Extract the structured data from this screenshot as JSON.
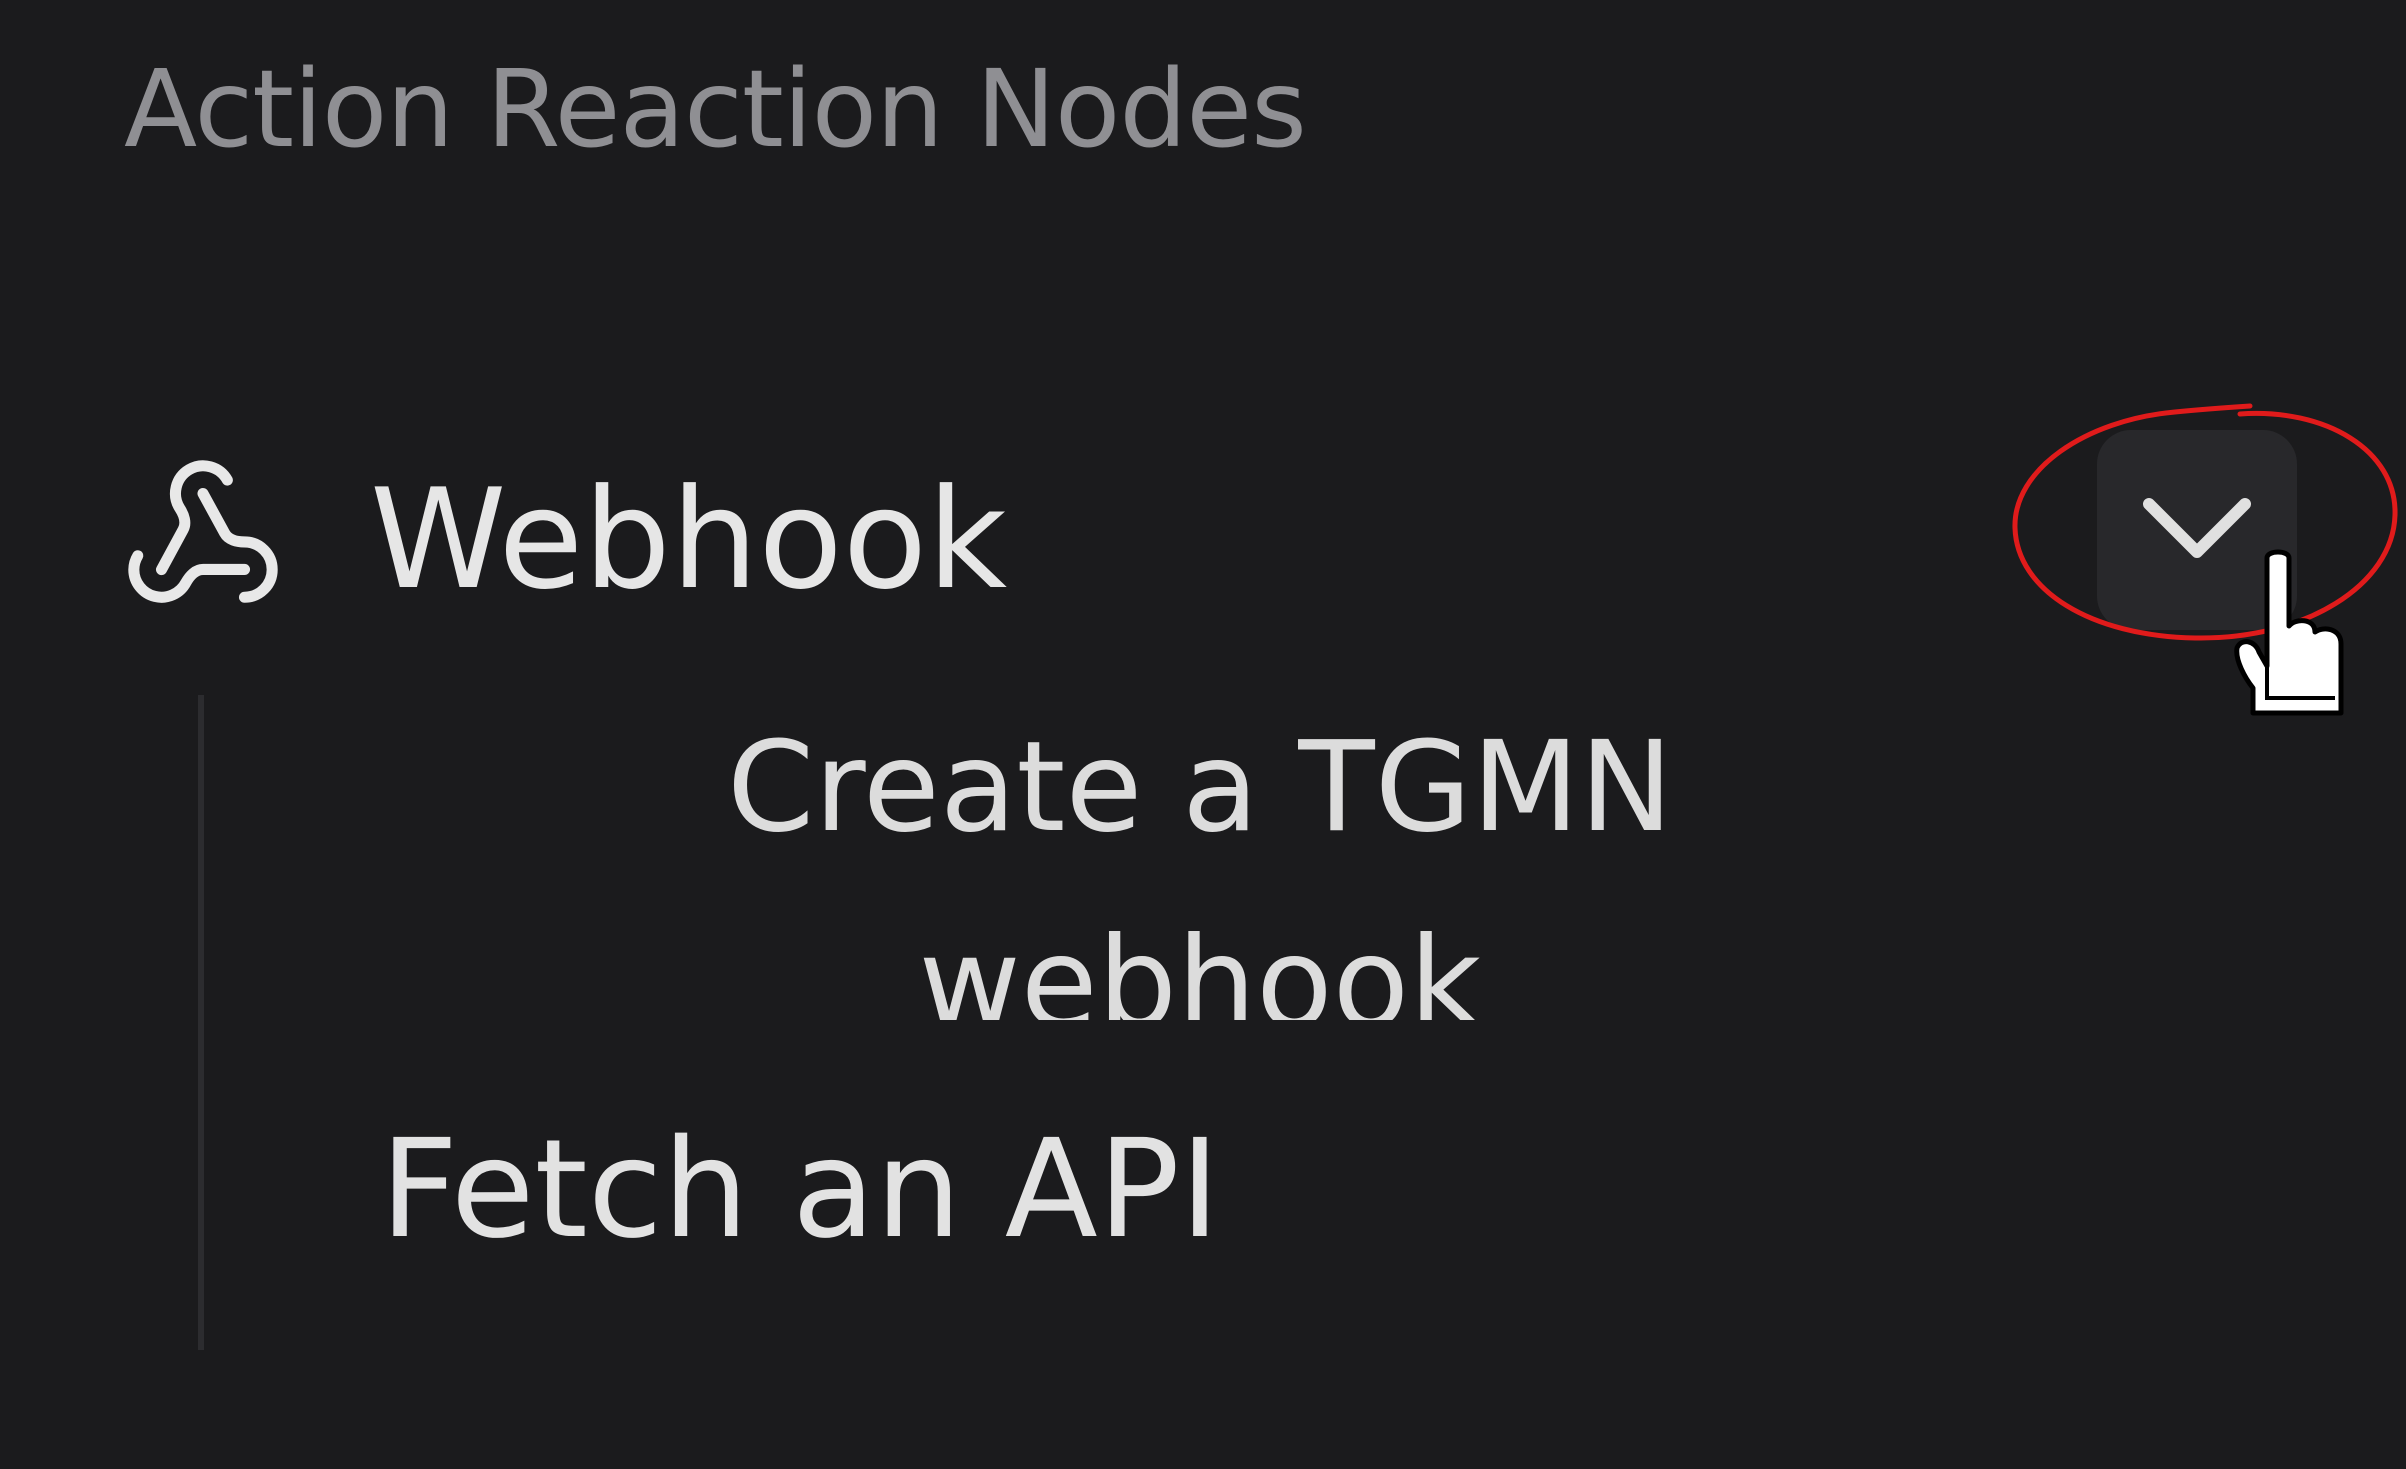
{
  "section": {
    "title": "Action Reaction Nodes"
  },
  "group": {
    "label": "Webhook",
    "icon": "webhook-icon",
    "expand_icon": "chevron-down-icon",
    "children": [
      {
        "label": "Create a TGMN webhook"
      },
      {
        "label": "Fetch an API"
      }
    ]
  },
  "annotation": {
    "color": "#e01b1b"
  },
  "colors": {
    "background": "#1b1b1d",
    "title_text": "#8f8f93",
    "item_text": "#e6e6e6",
    "button_bg": "#28282b"
  }
}
